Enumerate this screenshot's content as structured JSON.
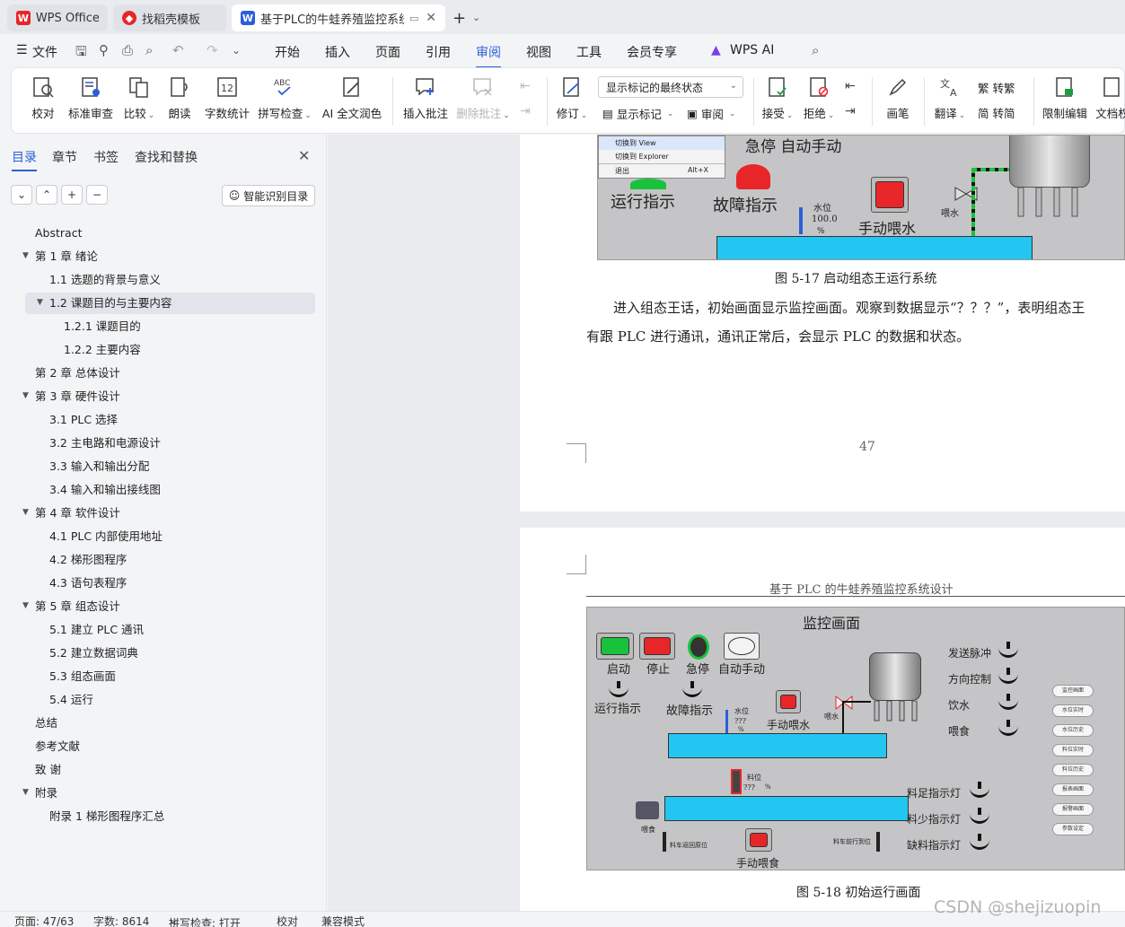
{
  "tabs": [
    {
      "label": "WPS Office"
    },
    {
      "label": "找稻壳模板"
    },
    {
      "label": "基于PLC的牛蛙养殖监控系统"
    }
  ],
  "menu": {
    "file": "文件",
    "items": [
      "开始",
      "插入",
      "页面",
      "引用",
      "审阅",
      "视图",
      "工具",
      "会员专享"
    ],
    "active": "审阅",
    "ai": "WPS AI"
  },
  "ribbon": {
    "proofread": "校对",
    "standard_review": "标准审查",
    "compare": "比较",
    "read_aloud": "朗读",
    "word_count": "字数统计",
    "spell_check": "拼写检查",
    "ai_polish": "AI 全文润色",
    "insert_comment": "插入批注",
    "delete_comment": "删除批注",
    "revise": "修订",
    "markup_mode": "显示标记的最终状态",
    "show_markup": "显示标记",
    "review_pane": "审阅",
    "accept": "接受",
    "reject": "拒绝",
    "pen": "画笔",
    "translate": "翻译",
    "to_traditional": "转繁",
    "to_simplified": "转简",
    "restrict_edit": "限制编辑",
    "doc_rights": "文档权"
  },
  "sidebar": {
    "tabs": [
      "目录",
      "章节",
      "书签",
      "查找和替换"
    ],
    "active_tab": "目录",
    "smart_button": "智能识别目录",
    "toc": [
      {
        "label": "Abstract",
        "level": 1,
        "expand": ""
      },
      {
        "label": "第 1 章  绪论",
        "level": 1,
        "expand": "▼"
      },
      {
        "label": "1.1  选题的背景与意义",
        "level": 2,
        "expand": ""
      },
      {
        "label": "1.2  课题目的与主要内容",
        "level": 2,
        "expand": "▼",
        "selected": true
      },
      {
        "label": "1.2.1  课题目的",
        "level": 3,
        "expand": ""
      },
      {
        "label": "1.2.2  主要内容",
        "level": 3,
        "expand": ""
      },
      {
        "label": "第 2 章    总体设计",
        "level": 1,
        "expand": ""
      },
      {
        "label": "第 3 章    硬件设计",
        "level": 1,
        "expand": "▼"
      },
      {
        "label": "3.1 PLC 选择",
        "level": 2,
        "expand": ""
      },
      {
        "label": "3.2  主电路和电源设计",
        "level": 2,
        "expand": ""
      },
      {
        "label": "3.3  输入和输出分配",
        "level": 2,
        "expand": ""
      },
      {
        "label": "3.4  输入和输出接线图",
        "level": 2,
        "expand": ""
      },
      {
        "label": "第 4 章    软件设计",
        "level": 1,
        "expand": "▼"
      },
      {
        "label": "4.1 PLC 内部使用地址",
        "level": 2,
        "expand": ""
      },
      {
        "label": "4.2  梯形图程序",
        "level": 2,
        "expand": ""
      },
      {
        "label": "4.3  语句表程序",
        "level": 2,
        "expand": ""
      },
      {
        "label": "第 5 章    组态设计",
        "level": 1,
        "expand": "▼"
      },
      {
        "label": "5.1  建立 PLC 通讯",
        "level": 2,
        "expand": ""
      },
      {
        "label": "5.2  建立数据词典",
        "level": 2,
        "expand": ""
      },
      {
        "label": "5.3  组态画面",
        "level": 2,
        "expand": ""
      },
      {
        "label": "5.4 运行",
        "level": 2,
        "expand": ""
      },
      {
        "label": "总结",
        "level": 1,
        "expand": ""
      },
      {
        "label": "参考文献",
        "level": 1,
        "expand": ""
      },
      {
        "label": "致  谢",
        "level": 1,
        "expand": ""
      },
      {
        "label": "附录",
        "level": 1,
        "expand": "▼"
      },
      {
        "label": "附录 1  梯形图程序汇总",
        "level": 2,
        "expand": ""
      }
    ]
  },
  "doc": {
    "page1": {
      "ctx_menu": [
        [
          "切换到  View",
          ""
        ],
        [
          "切换到  Explorer",
          ""
        ],
        [
          "退出",
          "Alt+X"
        ]
      ],
      "labels": {
        "estop_auto": "急停  自动手动",
        "run_ind": "运行指示",
        "fault_ind": "故障指示",
        "manual_water": "手动喂水",
        "water_level": "水位",
        "water_value": "100.0",
        "percent": "%",
        "feed_water": "喂水"
      },
      "caption": "图 5-17  启动组态王运行系统",
      "para_line1": "进入组态王话，初始画面显示监控画面。观察到数据显示“？？？”，表明组态王",
      "para_line2": "有跟 PLC 进行通讯，通讯正常后，会显示 PLC 的数据和状态。",
      "page_number": "47"
    },
    "page2": {
      "header": "基于 PLC 的牛蛙养殖监控系统设计",
      "scada_title": "监控画面",
      "buttons": [
        "启动",
        "停止",
        "急停",
        "自动手动"
      ],
      "run_ind": "运行指示",
      "fault_ind": "故障指示",
      "manual_water": "手动喂水",
      "manual_feed": "手动喂食",
      "water_level": "水位",
      "feed_level": "料位",
      "unknown": "???",
      "percent": "%",
      "feed_water": "喂水",
      "feeding": "喂食",
      "cart_return": "料车返回原位",
      "cart_forward": "料车前行到位",
      "right_switches": [
        "发送脉冲",
        "方向控制",
        "饮水",
        "喂食"
      ],
      "lamps": [
        "料足指示灯",
        "料少指示灯",
        "缺料指示灯"
      ],
      "nav": [
        "监控画面",
        "水位实时",
        "水位历史",
        "料位实时",
        "料位历史",
        "报表画面",
        "报警画面",
        "参数设定"
      ],
      "caption": "图 5-18  初始运行画面"
    }
  },
  "status": {
    "page": "页面: 47/63",
    "words": "字数: 8614",
    "spell": "拼写检查: 打开",
    "proof": "校对",
    "compat": "兼容模式"
  },
  "watermark": "CSDN @shejizuopin",
  "colors": {
    "accent": "#2b5fd9",
    "tank": "#23c6f0",
    "red": "#e8262a",
    "green": "#19c23c"
  }
}
